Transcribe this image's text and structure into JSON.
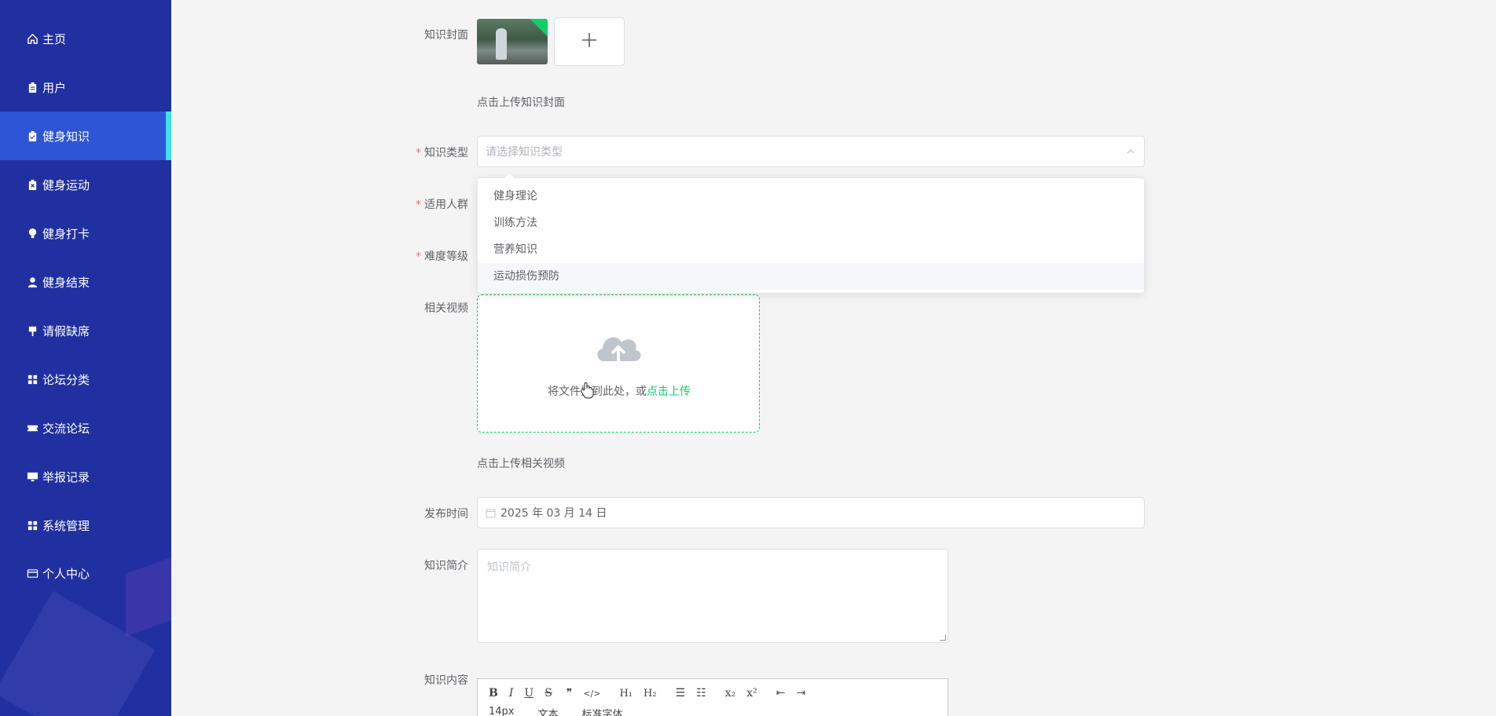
{
  "sidebar": {
    "items": [
      {
        "label": "主页",
        "icon": "home-icon"
      },
      {
        "label": "用户",
        "icon": "clipboard-icon"
      },
      {
        "label": "健身知识",
        "icon": "clipboard-check-icon",
        "active": true
      },
      {
        "label": "健身运动",
        "icon": "clipboard-x-icon"
      },
      {
        "label": "健身打卡",
        "icon": "bulb-icon"
      },
      {
        "label": "健身结束",
        "icon": "user-icon"
      },
      {
        "label": "请假缺席",
        "icon": "paintbrush-icon"
      },
      {
        "label": "论坛分类",
        "icon": "grid-icon"
      },
      {
        "label": "交流论坛",
        "icon": "ticket-icon"
      },
      {
        "label": "举报记录",
        "icon": "monitor-icon"
      },
      {
        "label": "系统管理",
        "icon": "grid-icon"
      },
      {
        "label": "个人中心",
        "icon": "card-icon"
      }
    ]
  },
  "form": {
    "cover_label": "知识封面",
    "cover_hint": "点击上传知识封面",
    "type_label": "知识类型",
    "type_placeholder": "请选择知识类型",
    "type_options": [
      "健身理论",
      "训练方法",
      "营养知识",
      "运动损伤预防"
    ],
    "crowd_label": "适用人群",
    "level_label": "难度等级",
    "video_label": "相关视频",
    "upload_text": "将文件拖到此处，或",
    "upload_link": "点击上传",
    "video_hint": "点击上传相关视频",
    "date_label": "发布时间",
    "date_value": "2025 年 03 月 14 日",
    "intro_label": "知识简介",
    "intro_placeholder": "知识简介",
    "content_label": "知识内容",
    "editor_size": "14px",
    "editor_format": "文本",
    "editor_font": "标准字体"
  },
  "colors": {
    "sidebar_bg": "#2130a0",
    "active_bg": "#2d55d6",
    "accent": "#13ce66",
    "required": "#f56c6c"
  }
}
